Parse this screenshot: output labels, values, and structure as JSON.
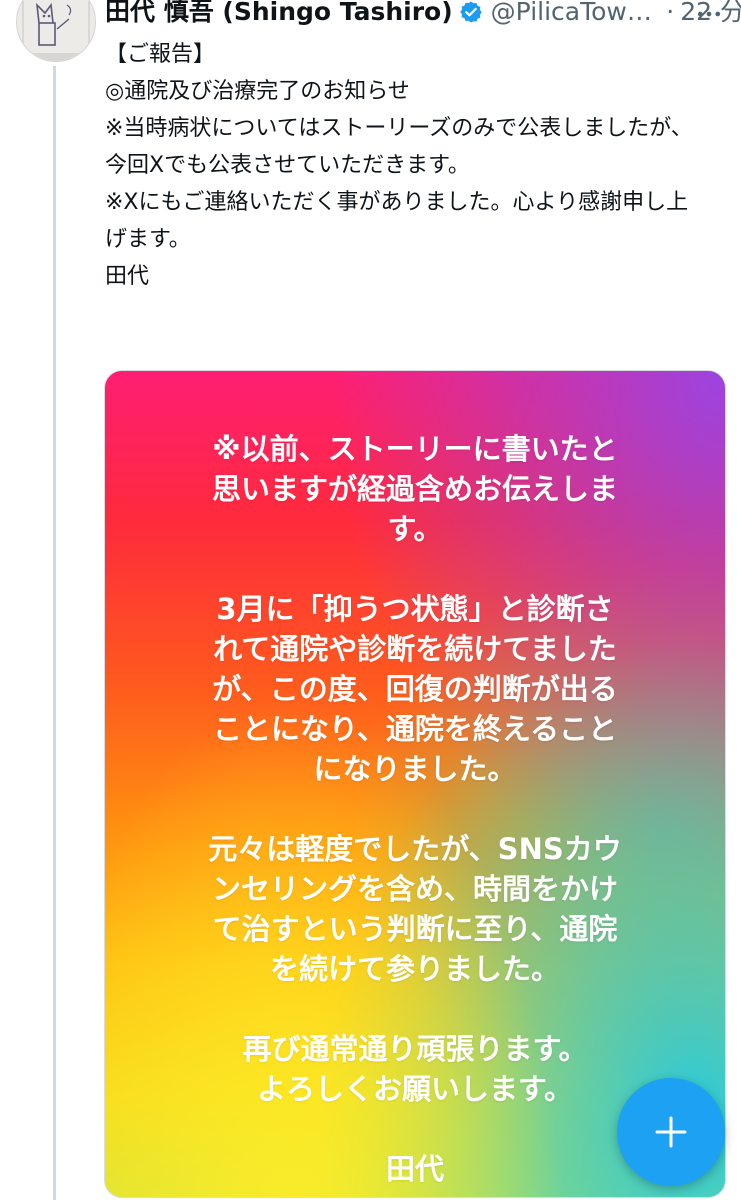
{
  "tweet": {
    "display_name": "田代 慎吾 (Shingo Tashiro)",
    "handle": "@PilicaTown...",
    "separator": "·",
    "time": "22 分",
    "text_lines": [
      "【ご報告】",
      "",
      "◎通院及び治療完了のお知らせ",
      "",
      "※当時病状についてはストーリーズのみで公表しましたが、",
      "今回Xでも公表させていただきます。",
      "※Xにもご連絡いただく事がありました。心より感謝申し上",
      "げます。",
      "",
      "田代"
    ],
    "icons": {
      "avatar": "avatar-drawing",
      "verified": "verified-badge-icon",
      "more": "more-options-icon"
    },
    "colors": {
      "verified": "#1d9bf0",
      "thread_line": "#cfd9de",
      "fab": "#1da1f2"
    }
  },
  "media": {
    "paragraphs": [
      [
        "※以前、ストーリーに書いたと",
        "思いますが経過含めお伝えしま",
        "す。"
      ],
      [
        "3月に「抑うつ状態」と診断さ",
        "れて通院や診断を続けてました",
        "が、この度、回復の判断が出る",
        "ことになり、通院を終えること",
        "になりました。"
      ],
      [
        "元々は軽度でしたが、SNSカウ",
        "ンセリングを含め、時間をかけ",
        "て治すという判断に至り、通院",
        "を続けて参りました。"
      ],
      [
        "再び通常通り頑張ります。",
        "よろしくお願いします。"
      ],
      [
        "田代"
      ]
    ],
    "text_color": "#ffffff"
  },
  "fab": {
    "icon": "plus-icon",
    "label": "+"
  }
}
